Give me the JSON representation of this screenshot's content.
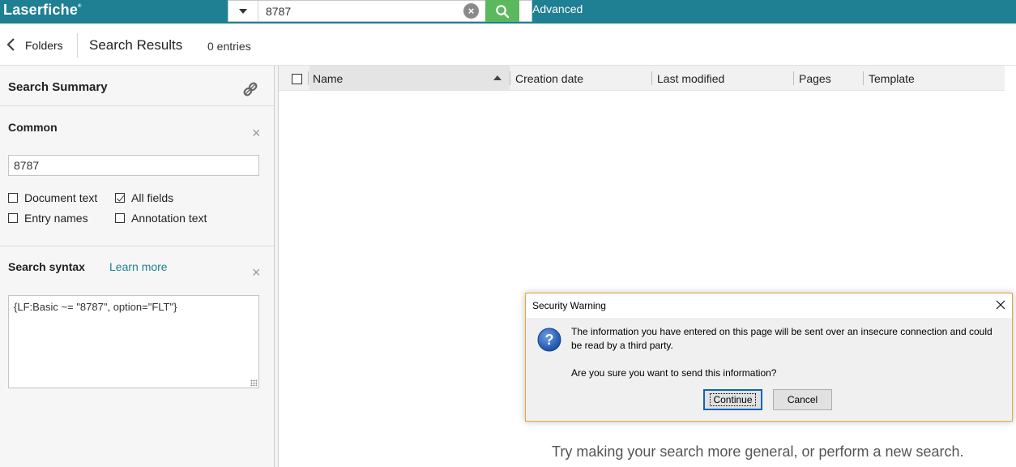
{
  "app": {
    "logo": "Laserfiche",
    "logo_mark": "®"
  },
  "search": {
    "value": "8787",
    "advanced_label": "Advanced"
  },
  "nav": {
    "back_label": "Folders",
    "title": "Search Results",
    "entry_count": "0 entries"
  },
  "summary": {
    "title": "Search Summary",
    "common": {
      "label": "Common",
      "query": "8787",
      "options": [
        {
          "label": "Document text",
          "checked": false
        },
        {
          "label": "All fields",
          "checked": true
        },
        {
          "label": "Entry names",
          "checked": false
        },
        {
          "label": "Annotation text",
          "checked": false
        }
      ]
    },
    "syntax": {
      "label": "Search syntax",
      "learn_more": "Learn more",
      "value": "{LF:Basic ~= \"8787\", option=\"FLT\"}"
    }
  },
  "grid": {
    "columns": [
      "Name",
      "Creation date",
      "Last modified",
      "Pages",
      "Template"
    ],
    "sorted_column": "Name",
    "sort_direction": "ascending",
    "empty_message": "Try making your search more general, or perform a new search."
  },
  "dialog": {
    "title": "Security Warning",
    "message": "The information you have entered on this page will be sent over an insecure connection and could be read by a third party.",
    "question": "Are you sure you want to send this information?",
    "continue_label": "Continue",
    "cancel_label": "Cancel",
    "border_color": "#e8a33d"
  },
  "colors": {
    "topbar": "#1f7f93",
    "search_button": "#5cb85c",
    "link": "#1f7f93"
  }
}
